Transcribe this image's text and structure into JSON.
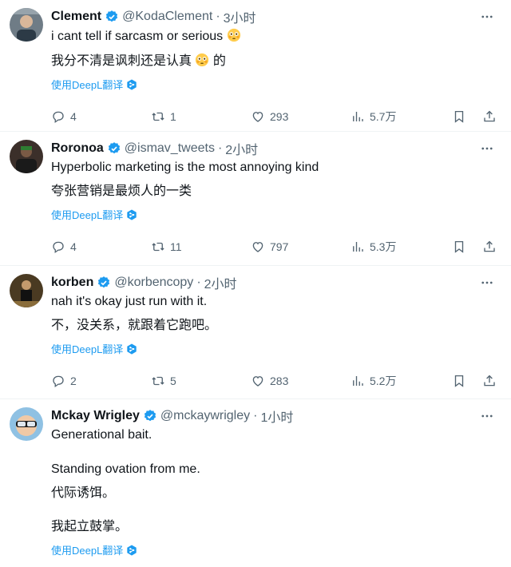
{
  "colors": {
    "accent": "#1d9bf0",
    "secondary_text": "#536471",
    "primary_text": "#0f1419",
    "divider": "#eff3f4"
  },
  "translate_label": "使用DeepL翻译",
  "tweets": [
    {
      "name": "Clement",
      "handle": "@KodaClement",
      "time": "3小时",
      "text_en": "i cant tell if sarcasm or serious",
      "text_en_emoji": "flushed-face-emoji",
      "text_zh": "我分不清是讽刺还是认真",
      "text_zh_suffix": "的",
      "replies": "4",
      "retweets": "1",
      "likes": "293",
      "views": "5.7万"
    },
    {
      "name": "Roronoa",
      "handle": "@ismav_tweets",
      "time": "2小时",
      "text_en": "Hyperbolic marketing is the most annoying kind",
      "text_zh": "夸张营销是最烦人的一类",
      "replies": "4",
      "retweets": "11",
      "likes": "797",
      "views": "5.3万"
    },
    {
      "name": "korben",
      "handle": "@korbencopy",
      "time": "2小时",
      "text_en": "nah it's okay just run with it.",
      "text_zh": "不，没关系，就跟着它跑吧。",
      "replies": "2",
      "retweets": "5",
      "likes": "283",
      "views": "5.2万"
    },
    {
      "name": "Mckay Wrigley",
      "handle": "@mckaywrigley",
      "time": "1小时",
      "text_en": "Generational bait.",
      "text_en_2": "Standing ovation from me.",
      "text_zh": "代际诱饵。",
      "text_zh_2": "我起立鼓掌。"
    }
  ]
}
